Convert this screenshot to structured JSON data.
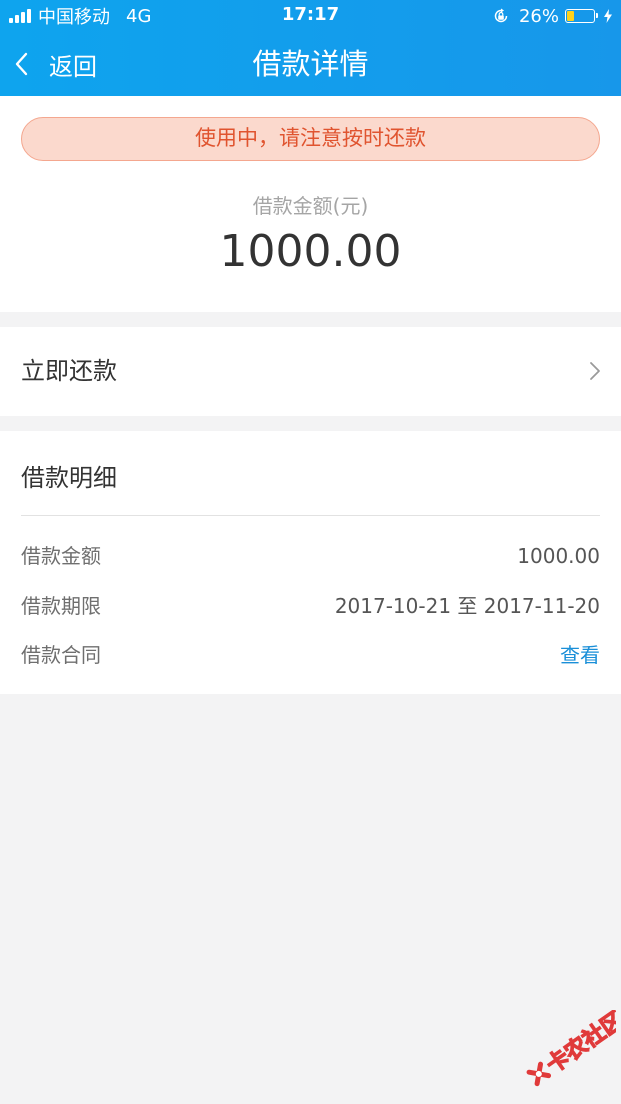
{
  "status_bar": {
    "carrier": "中国移动",
    "network": "4G",
    "time": "17:17",
    "battery_percent": "26%",
    "battery_level": 0.26
  },
  "nav": {
    "back_label": "返回",
    "title": "借款详情"
  },
  "summary": {
    "notice": "使用中，请注意按时还款",
    "amount_label": "借款金额(元)",
    "amount_value": "1000.00"
  },
  "repay": {
    "label": "立即还款"
  },
  "details": {
    "title": "借款明细",
    "rows": [
      {
        "label": "借款金额",
        "value": "1000.00"
      },
      {
        "label": "借款期限",
        "value": "2017-10-21 至 2017-11-20"
      },
      {
        "label": "借款合同",
        "value": "查看"
      }
    ]
  },
  "watermark": {
    "text": "卡农社区"
  },
  "colors": {
    "header": "#1797ea",
    "notice_bg": "#fbd9cd",
    "notice_text": "#e0542f",
    "link": "#1a8fd8",
    "page_bg": "#f3f3f4"
  }
}
